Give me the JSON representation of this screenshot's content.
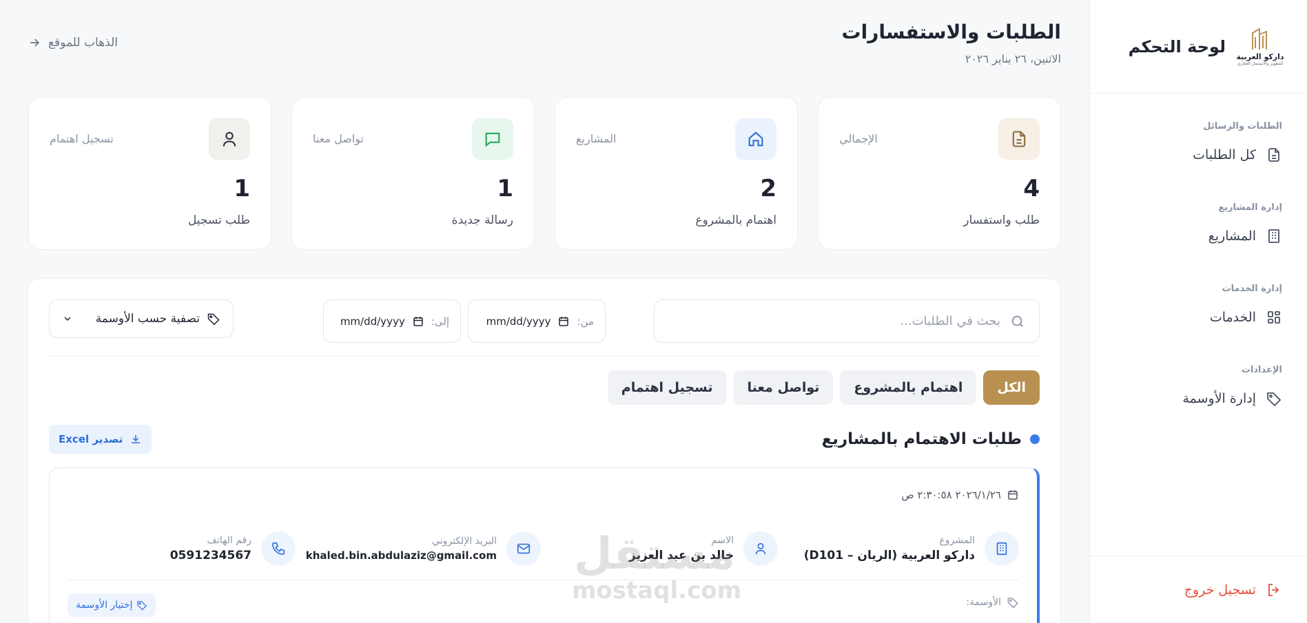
{
  "sidebar": {
    "brand_title": "لوحة التحكم",
    "logo_name": "داركو العربية",
    "logo_sub": "للتطوير والاستثمار العقاري",
    "sections": [
      {
        "heading": "الطلبات والرسائل",
        "item": "كل الطلبات"
      },
      {
        "heading": "إدارة المشاريع",
        "item": "المشاريع"
      },
      {
        "heading": "إدارة الخدمات",
        "item": "الخدمات"
      },
      {
        "heading": "الإعدادات",
        "item": "إدارة الأوسمة"
      }
    ],
    "logout": "تسجيل خروج"
  },
  "header": {
    "title": "الطلبات والاستفسارات",
    "date": "الاثنين، ٢٦ يناير ٢٠٢٦",
    "goto_site": "الذهاب للموقع"
  },
  "stats": [
    {
      "label": "الإجمالي",
      "value": "4",
      "sub": "طلب واستفسار",
      "icon": "document-icon",
      "color": "#8a6a3c",
      "bg": "#f5efe6"
    },
    {
      "label": "المشاريع",
      "value": "2",
      "sub": "اهتمام بالمشروع",
      "icon": "home-icon",
      "color": "#2f6fd6",
      "bg": "#eaf2fe"
    },
    {
      "label": "تواصل معنا",
      "value": "1",
      "sub": "رسالة جديدة",
      "icon": "chat-icon",
      "color": "#22a559",
      "bg": "#e8f7ee"
    },
    {
      "label": "تسجيل اهتمام",
      "value": "1",
      "sub": "طلب تسجيل",
      "icon": "user-icon",
      "color": "#2b3140",
      "bg": "#f0f1ec"
    }
  ],
  "filters": {
    "search_placeholder": "بحث في الطلبات...",
    "from_label": "من:",
    "to_label": "إلى:",
    "date_placeholder": "mm/dd/yyyy",
    "tag_filter": "تصفية حسب الأوسمة"
  },
  "tabs": [
    "الكل",
    "اهتمام بالمشروع",
    "تواصل معنا",
    "تسجيل اهتمام"
  ],
  "section": {
    "title": "طلبات الاهتمام بالمشاريع",
    "export": "تصدير Excel"
  },
  "request": {
    "datetime": "٢٠٢٦/١/٢٦ ٢:٣٠:٥٨ ص",
    "project_label": "المشروع",
    "project_value": "داركو العربية (الريان – D101)",
    "name_label": "الاسم",
    "name_value": "خالد بن عبد العزيز",
    "email_label": "البريد الإلكتروني",
    "email_value": "khaled.bin.abdulaziz@gmail.com",
    "phone_label": "رقم الهاتف",
    "phone_value": "0591234567",
    "tags_label": "الأوسمة:",
    "choose_tags": "إختيار الأوسمة"
  },
  "watermark": {
    "ar": "مستقل",
    "en": "mostaql.com"
  }
}
